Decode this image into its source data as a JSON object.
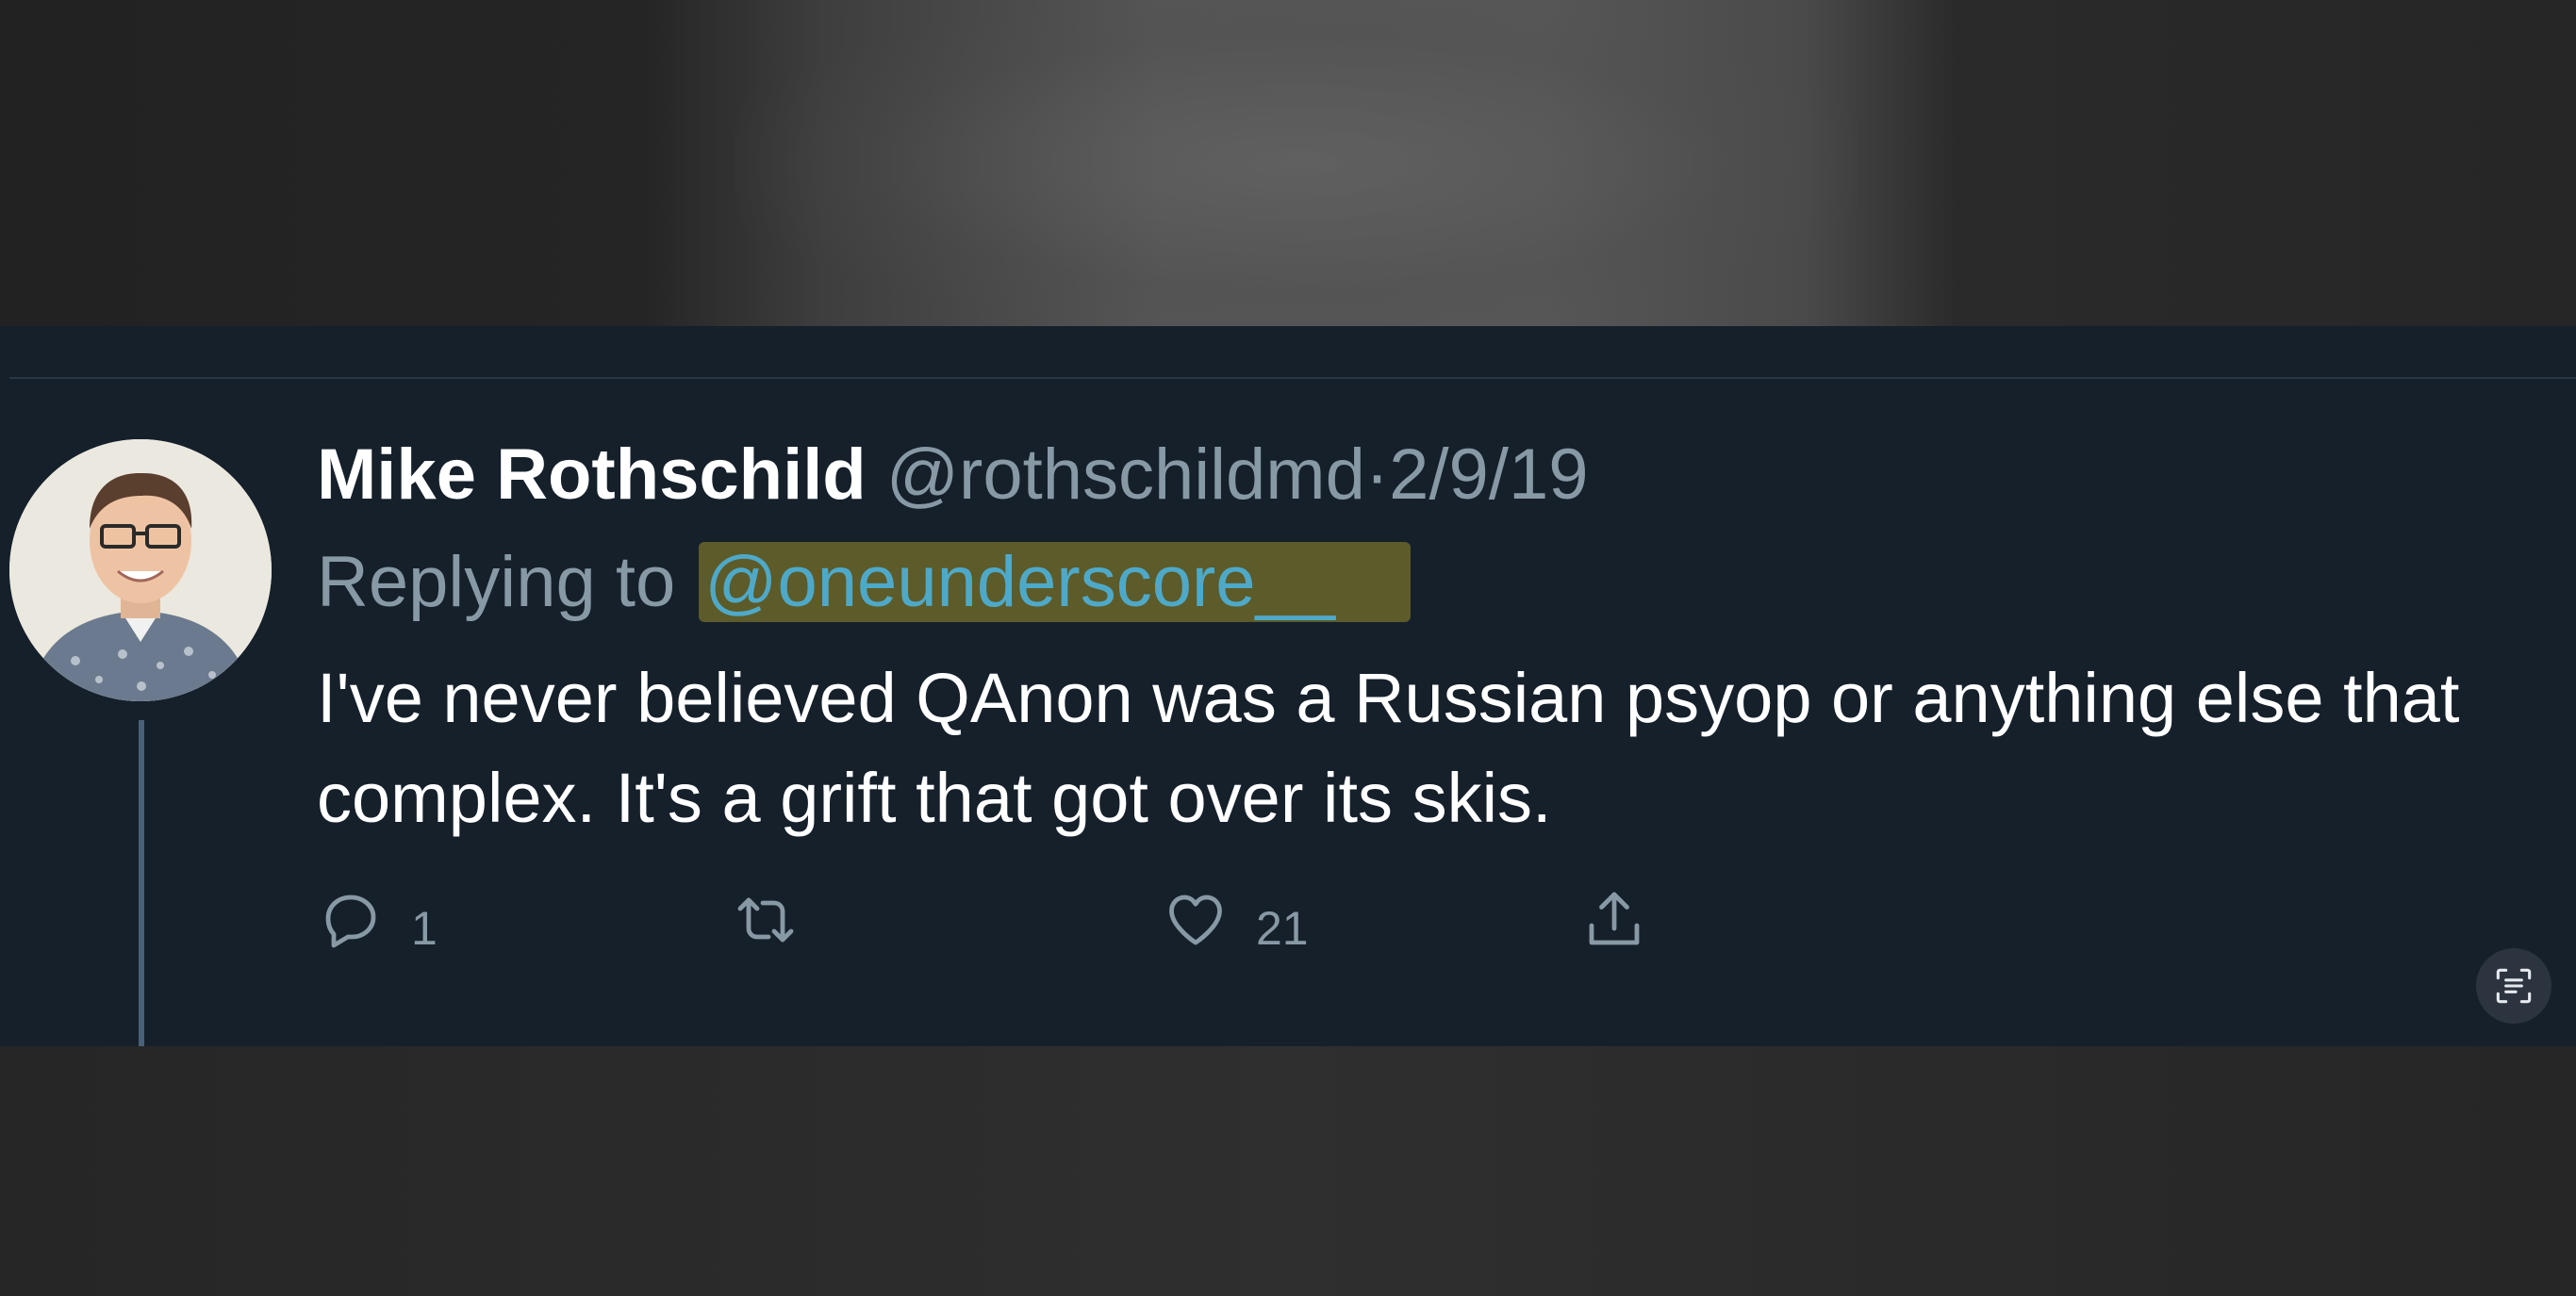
{
  "tweet": {
    "display_name": "Mike Rothschild",
    "handle": "@rothschildmd",
    "separator": "·",
    "date": "2/9/19",
    "replying_prefix": "Replying to",
    "replying_to": "@oneunderscore__",
    "text": "I've never believed QAnon was a Russian psyop or anything else that complex. It's a grift that got over its skis."
  },
  "actions": {
    "reply_count": "1",
    "like_count": "21"
  },
  "icons": {
    "reply": "reply-icon",
    "retweet": "retweet-icon",
    "like": "heart-icon",
    "share": "share-icon",
    "live_text": "live-text-scan-icon"
  },
  "colors": {
    "tweet_background": "#15202b",
    "secondary_text": "#8899a6",
    "mention": "#4ea9c9",
    "highlight": "#968c28"
  }
}
